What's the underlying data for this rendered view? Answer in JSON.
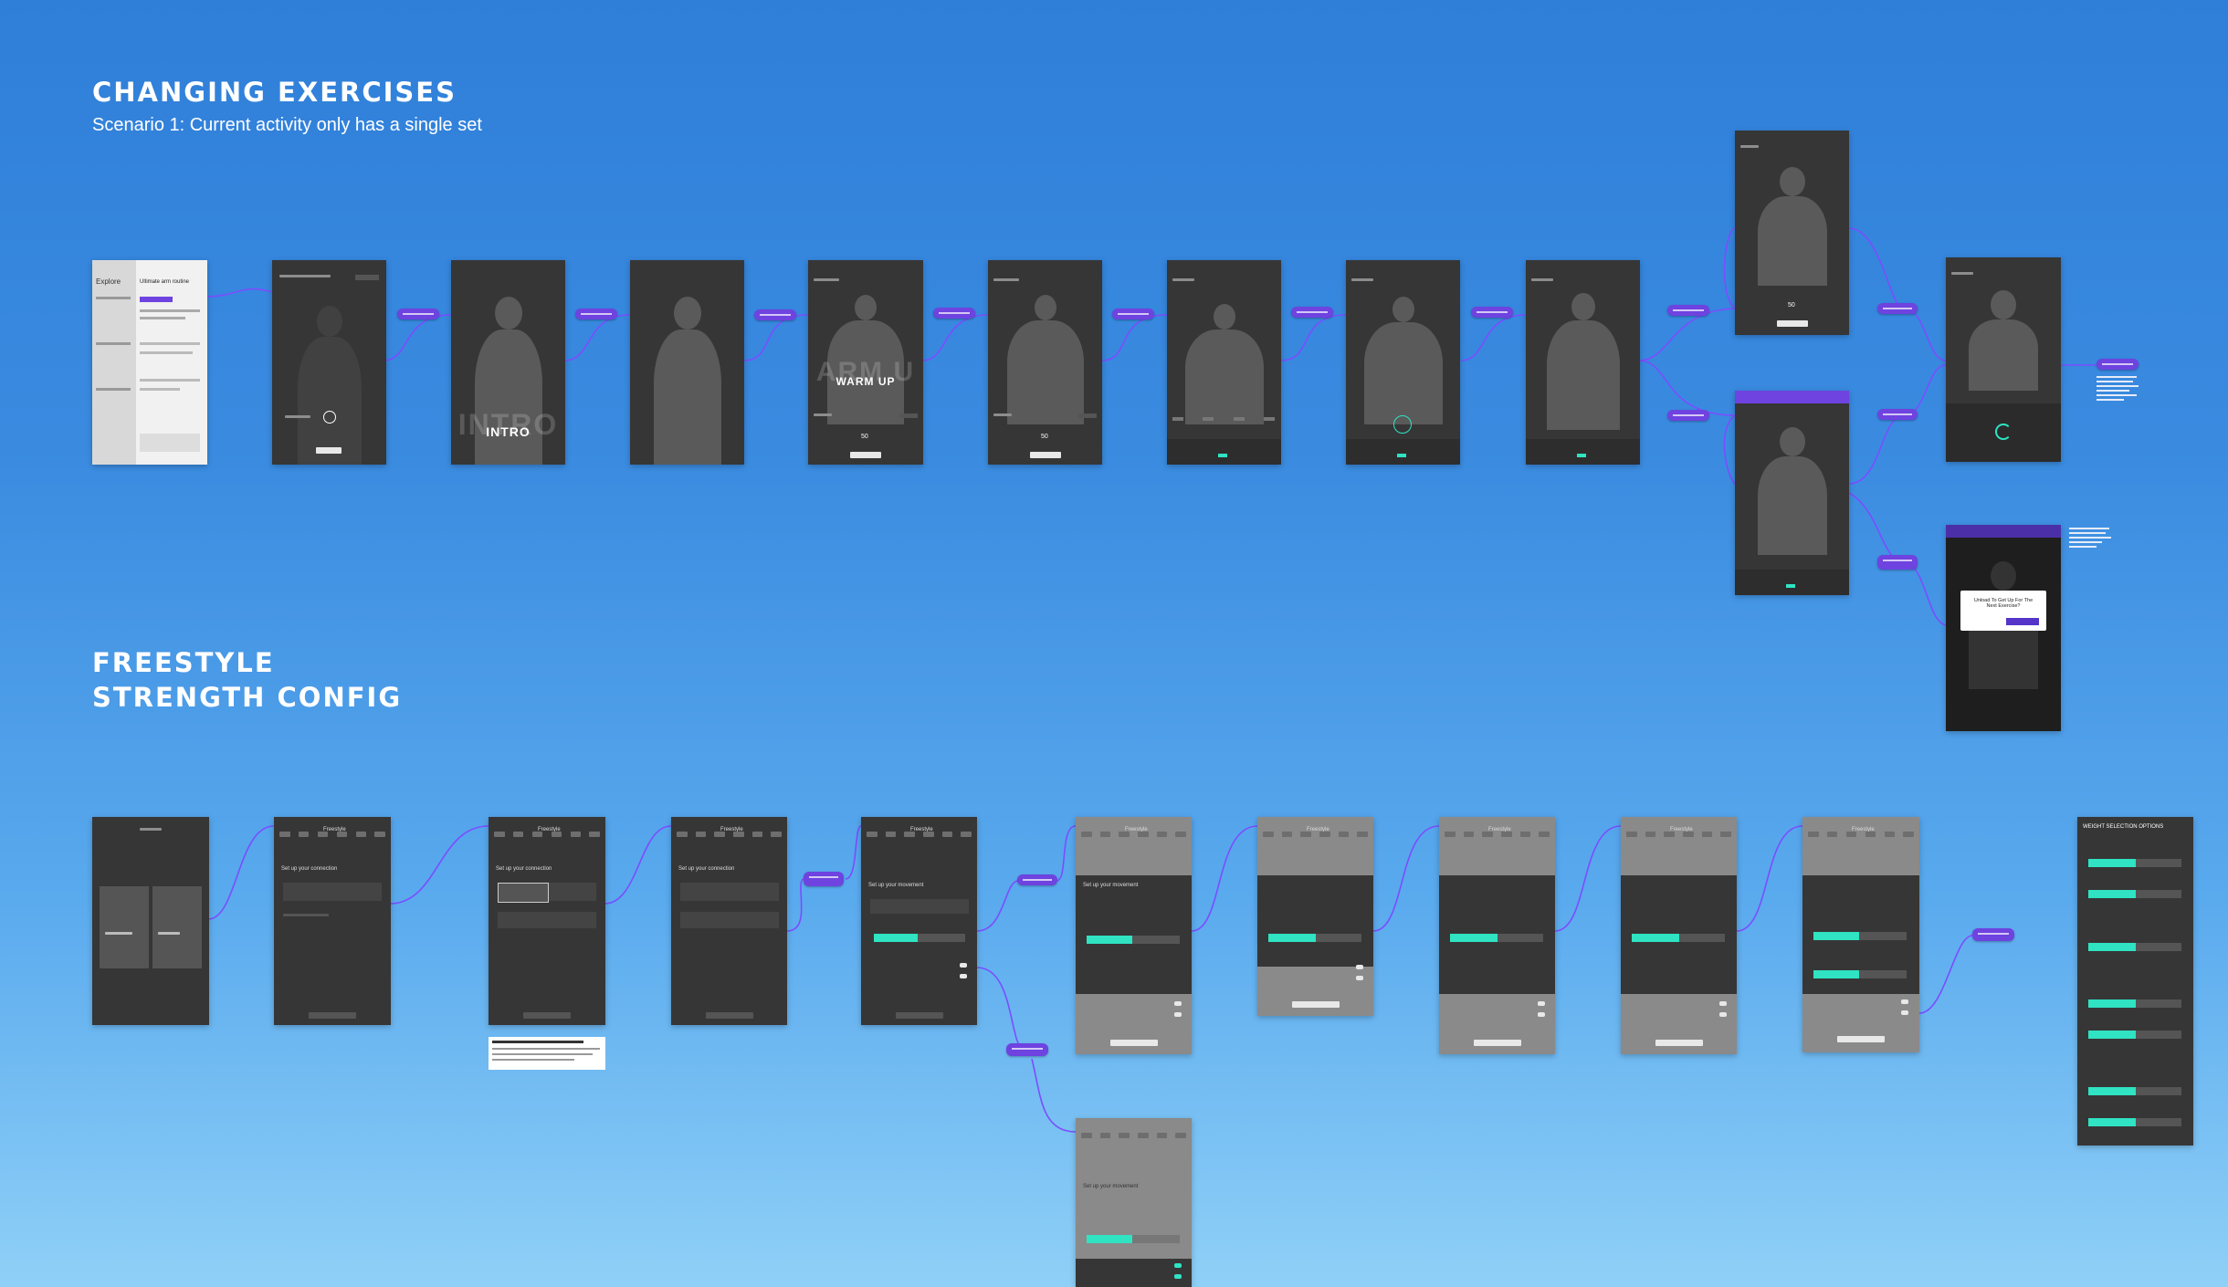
{
  "sections": {
    "changing_exercises": {
      "title": "CHANGING EXERCISES",
      "subtitle": "Scenario 1: Current activity only has a single set"
    },
    "freestyle": {
      "title": "FREESTYLE\nSTRENGTH CONFIG"
    }
  },
  "screen_labels": {
    "intro": "INTRO",
    "warm_up": "WARM UP",
    "warm_up_ghost": "ARM U",
    "intro_ghost": "INTRO"
  },
  "screens": {
    "explore_title": "Explore",
    "explore_heading": "Ultimate arm routine",
    "modal_title": "Unload To Get Up For The Next Exercise?",
    "freestyle_header": "Freestyle",
    "set_up_connection": "Set up your connection",
    "set_up_movement": "Set up your movement",
    "weight_options_title": "WEIGHT SELECTION OPTIONS",
    "rep_value": "50"
  },
  "colors": {
    "accent_purple": "#6e43e0",
    "teal": "#2fe3c3",
    "screen_dark": "#363636",
    "connector": "#7c4dff"
  }
}
